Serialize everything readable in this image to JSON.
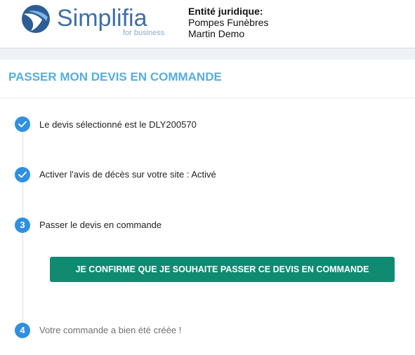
{
  "header": {
    "logo_text": "Simplifia",
    "logo_subtext": "for business",
    "entity_label": "Entité juridique:",
    "entity_line1": "Pompes Funèbres",
    "entity_line2": "Martin Demo"
  },
  "page": {
    "title": "PASSER MON DEVIS EN COMMANDE"
  },
  "steps": [
    {
      "marker": "",
      "status": "done",
      "label": "Le devis sélectionné est le DLY200570"
    },
    {
      "marker": "",
      "status": "done",
      "label": "Activer l'avis de décès sur votre site : Activé"
    },
    {
      "marker": "3",
      "status": "active",
      "label": "Passer le devis en commande"
    },
    {
      "marker": "4",
      "status": "pending",
      "label": "Votre commande a bien été créée !"
    }
  ],
  "confirm_button": {
    "label": "JE CONFIRME QUE JE SOUHAITE PASSER CE DEVIS EN COMMANDE"
  },
  "colors": {
    "brand_blue": "#3f6fa6",
    "title_blue": "#55aee0",
    "step_blue": "#2f8fe0",
    "button_green": "#118a72"
  },
  "icons": {
    "logo": "simplifia-logo-icon",
    "done_step": "checkmark-icon"
  }
}
